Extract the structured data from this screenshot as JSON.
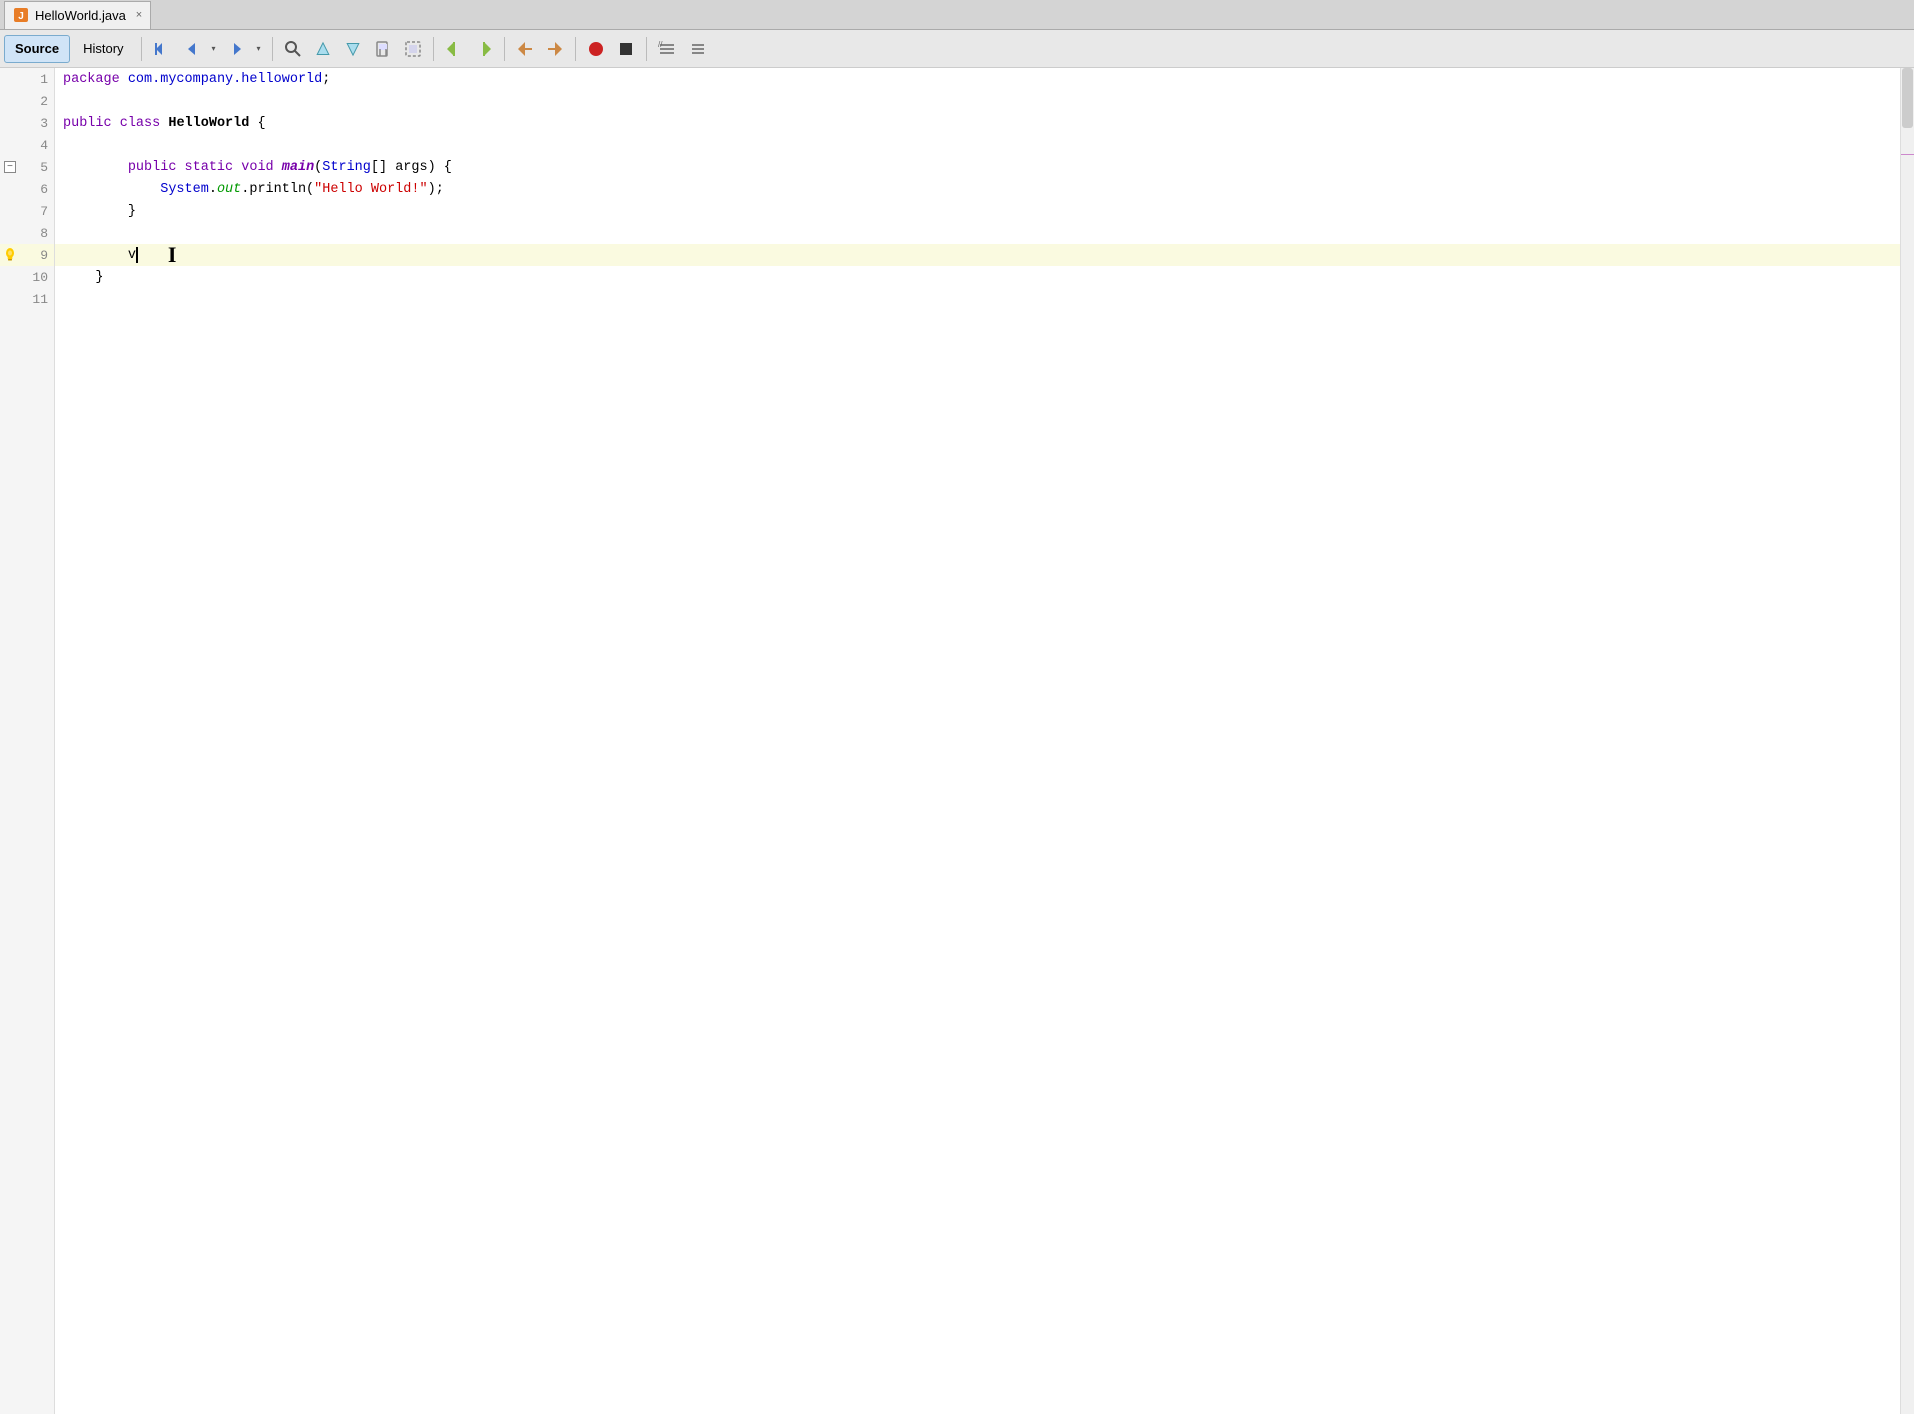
{
  "tab": {
    "icon": "java-file-icon",
    "label": "HelloWorld.java",
    "close_label": "×"
  },
  "toolbar": {
    "source_label": "Source",
    "history_label": "History",
    "buttons": [
      {
        "name": "first-btn",
        "icon": "navigate-first"
      },
      {
        "name": "back-btn",
        "icon": "navigate-back"
      },
      {
        "name": "back-dropdown",
        "icon": "dropdown-arrow"
      },
      {
        "name": "forward-btn",
        "icon": "navigate-forward"
      },
      {
        "name": "forward-dropdown",
        "icon": "dropdown-arrow"
      },
      {
        "name": "search-btn",
        "icon": "search"
      },
      {
        "name": "prev-occurrence-btn",
        "icon": "prev-occurrence"
      },
      {
        "name": "next-occurrence-btn",
        "icon": "next-occurrence"
      },
      {
        "name": "toggle-bookmark-btn",
        "icon": "toggle-bookmark"
      },
      {
        "name": "toggle-select-btn",
        "icon": "toggle-select"
      },
      {
        "name": "prev-member-btn",
        "icon": "prev-member"
      },
      {
        "name": "next-member-btn",
        "icon": "next-member"
      },
      {
        "name": "prev-edit-btn",
        "icon": "prev-edit"
      },
      {
        "name": "next-edit-btn",
        "icon": "next-edit"
      },
      {
        "name": "record-btn",
        "icon": "record"
      },
      {
        "name": "stop-btn",
        "icon": "stop"
      },
      {
        "name": "comment-btn",
        "icon": "comment"
      },
      {
        "name": "uncomment-btn",
        "icon": "uncomment"
      }
    ]
  },
  "code": {
    "lines": [
      {
        "num": 1,
        "content": "package_line",
        "fold": false,
        "hint": false
      },
      {
        "num": 2,
        "content": "empty",
        "fold": false,
        "hint": false
      },
      {
        "num": 3,
        "content": "class_decl",
        "fold": false,
        "hint": false
      },
      {
        "num": 4,
        "content": "empty",
        "fold": false,
        "hint": false
      },
      {
        "num": 5,
        "content": "main_method",
        "fold": true,
        "hint": false
      },
      {
        "num": 6,
        "content": "println",
        "fold": false,
        "hint": false
      },
      {
        "num": 7,
        "content": "close_main",
        "fold": false,
        "hint": false
      },
      {
        "num": 8,
        "content": "empty",
        "fold": false,
        "hint": false
      },
      {
        "num": 9,
        "content": "cursor_line",
        "fold": false,
        "hint": true,
        "highlighted": true
      },
      {
        "num": 10,
        "content": "close_class",
        "fold": false,
        "hint": false
      },
      {
        "num": 11,
        "content": "empty",
        "fold": false,
        "hint": false
      }
    ]
  },
  "colors": {
    "highlight_line": "#fafae0",
    "keyword": "#7700aa",
    "string": "#cc0000",
    "type": "#0000cc",
    "method_italic": "#7700aa",
    "out_color": "#009900"
  }
}
